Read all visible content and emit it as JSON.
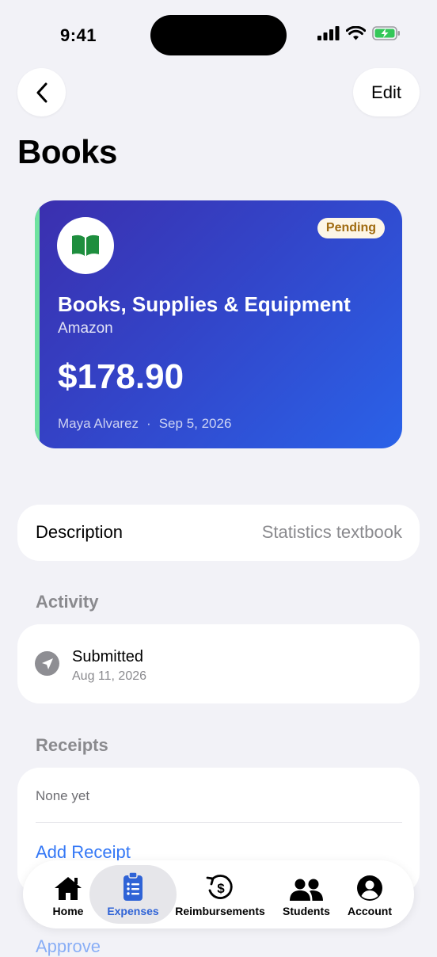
{
  "status_bar": {
    "time": "9:41"
  },
  "nav": {
    "edit_label": "Edit"
  },
  "page": {
    "title": "Books"
  },
  "expense_card": {
    "status_badge": "Pending",
    "category": "Books, Supplies & Equipment",
    "merchant": "Amazon",
    "amount": "$178.90",
    "student": "Maya Alvarez",
    "separator": "·",
    "date": "Sep 5, 2026",
    "icon": "book-icon",
    "colors": {
      "gradient_start": "#3b2fae",
      "gradient_end": "#2a62e8",
      "accent": "#6fe3a0",
      "badge_text": "#a06b10"
    }
  },
  "description": {
    "label": "Description",
    "value": "Statistics textbook"
  },
  "activity": {
    "heading": "Activity",
    "items": [
      {
        "title": "Submitted",
        "date": "Aug 11, 2026",
        "icon": "paper-plane-icon"
      }
    ]
  },
  "receipts": {
    "heading": "Receipts",
    "empty_text": "None yet",
    "add_label": "Add Receipt"
  },
  "approve_label": "Approve",
  "tabbar": {
    "active": "Expenses",
    "tabs": [
      {
        "label": "Home",
        "icon": "house-icon"
      },
      {
        "label": "Expenses",
        "icon": "clipboard-list-icon"
      },
      {
        "label": "Reimbursements",
        "icon": "refund-dollar-icon"
      },
      {
        "label": "Students",
        "icon": "people-icon"
      },
      {
        "label": "Account",
        "icon": "person-circle-icon"
      }
    ]
  }
}
